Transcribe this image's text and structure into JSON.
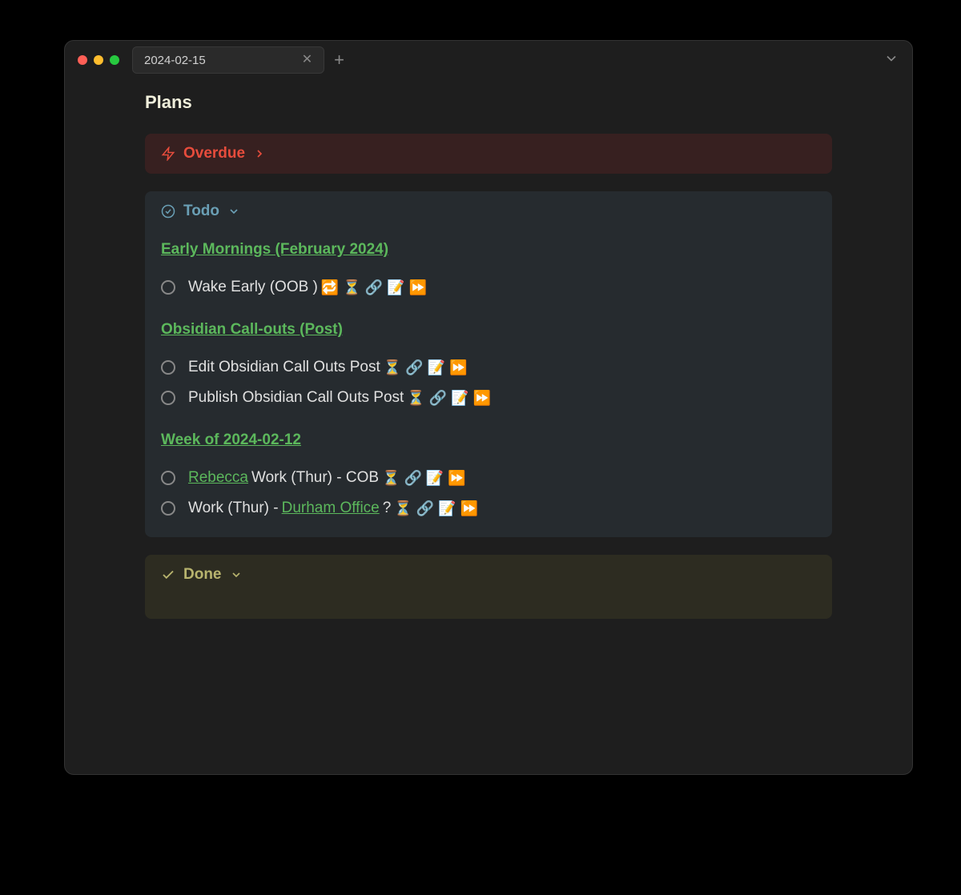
{
  "tab": {
    "title": "2024-02-15"
  },
  "page": {
    "title": "Plans"
  },
  "callouts": {
    "overdue": {
      "title": "Overdue"
    },
    "todo": {
      "title": "Todo",
      "groups": [
        {
          "title": "Early Mornings (February 2024)",
          "tasks": [
            {
              "text": "Wake Early (OOB )",
              "icons": "🔁 ⏳ 🔗 📝 ⏩"
            }
          ]
        },
        {
          "title": "Obsidian Call-outs (Post)",
          "tasks": [
            {
              "text": "Edit Obsidian Call Outs Post",
              "icons": "⏳ 🔗 📝 ⏩"
            },
            {
              "text": "Publish Obsidian Call Outs Post",
              "icons": "⏳ 🔗 📝 ⏩"
            }
          ]
        },
        {
          "title": "Week of 2024-02-12",
          "tasks": [
            {
              "link_prefix": "Rebecca",
              "text": " Work (Thur) - COB",
              "icons": "⏳ 🔗 📝 ⏩"
            },
            {
              "text_prefix": "Work (Thur) - ",
              "link": "Durham Office",
              "text_suffix": "?",
              "icons": "⏳ 🔗 📝 ⏩"
            }
          ]
        }
      ]
    },
    "done": {
      "title": "Done"
    }
  }
}
